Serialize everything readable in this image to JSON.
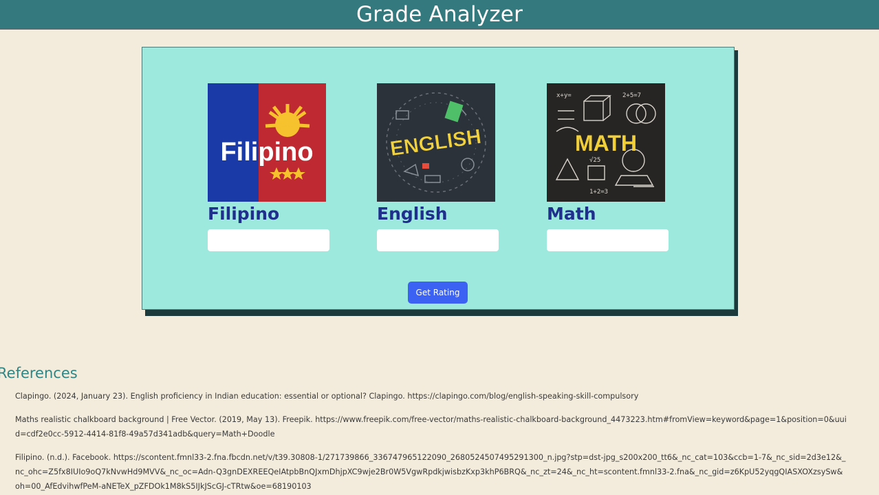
{
  "header": {
    "title": "Grade Analyzer"
  },
  "subjects": [
    {
      "name": "Filipino",
      "image_text": "Filipino",
      "value": "",
      "placeholder": ""
    },
    {
      "name": "English",
      "image_text": "ENGLISH",
      "value": "",
      "placeholder": ""
    },
    {
      "name": "Math",
      "image_text": "MATH",
      "value": "",
      "placeholder": ""
    }
  ],
  "actions": {
    "get_rating_label": "Get Rating"
  },
  "references": {
    "title": "References",
    "items": [
      "Clapingo. (2024, January 23). English proficiency in Indian education: essential or optional? Clapingo. https://clapingo.com/blog/english-speaking-skill-compulsory",
      "Maths realistic chalkboard background | Free Vector. (2019, May 13). Freepik. https://www.freepik.com/free-vector/maths-realistic-chalkboard-background_4473223.htm#fromView=keyword&page=1&position=0&uuid=cdf2e0cc-5912-4414-81f8-49a57d341adb&query=Math+Doodle",
      "Filipino. (n.d.). Facebook. https://scontent.fmnl33-2.fna.fbcdn.net/v/t39.30808-1/271739866_336747965122090_2680524507495291300_n.jpg?stp=dst-jpg_s200x200_tt6&_nc_cat=103&ccb=1-7&_nc_sid=2d3e12&_nc_ohc=Z5fx8IUIo9oQ7kNvwHd9MVV&_nc_oc=Adn-Q3gnDEXREEQeIAtpbBnQJxmDhjpXC9wje2Br0W5VgwRpdkjwisbzKxp3khP6BRQ&_nc_zt=24&_nc_ht=scontent.fmnl33-2.fna&_nc_gid=z6KpU52yqgQIASXOXzsySw&oh=00_AfEdvihwfPeM-aNETeX_pZFDOk1M8kS5IJkJScGJ-cTRtw&oe=68190103"
    ]
  },
  "colors": {
    "header_bg": "#33797e",
    "card_bg": "#9ee9de",
    "button_bg": "#3b62f2",
    "subject_label": "#1e2f8c",
    "references_title": "#2f8584",
    "page_bg": "#f3ecdc"
  }
}
